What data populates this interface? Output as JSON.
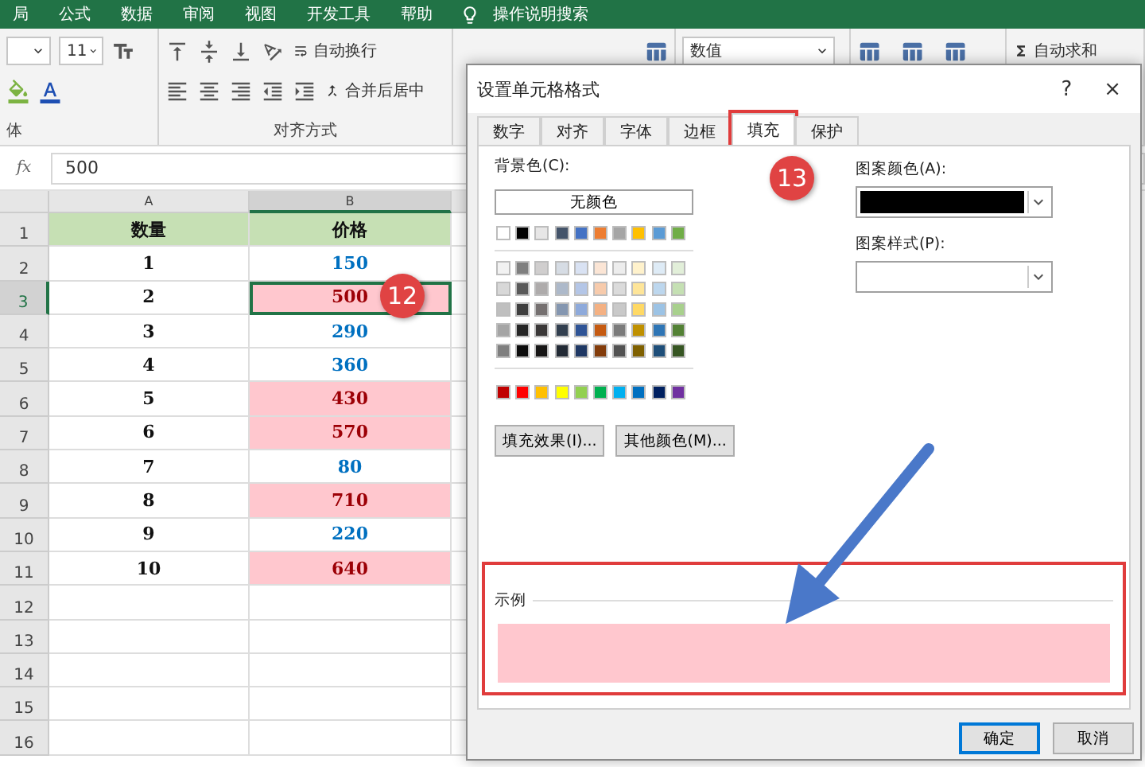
{
  "ribbon_tabs": [
    "局",
    "公式",
    "数据",
    "审阅",
    "视图",
    "开发工具",
    "帮助"
  ],
  "ribbon": {
    "search": "操作说明搜索",
    "font_size": "11",
    "font_group_label": "体",
    "wrap_text": "自动换行",
    "merge_center": "合并后居中",
    "alignment_group_label": "对齐方式",
    "number_format": "数值",
    "autosum": "自动求和"
  },
  "formula_bar": {
    "function_label": "fx",
    "value": "500"
  },
  "sheet": {
    "columns": [
      {
        "label": "A",
        "selected": false
      },
      {
        "label": "B",
        "selected": true
      }
    ],
    "rows": [
      {
        "number": "1",
        "selected": false,
        "kind": "header",
        "a": "数量",
        "b": "价格"
      },
      {
        "number": "2",
        "selected": false,
        "kind": "data",
        "a": "1",
        "b": "150",
        "highlighted": false
      },
      {
        "number": "3",
        "selected": true,
        "kind": "data",
        "a": "2",
        "b": "500",
        "highlighted": true
      },
      {
        "number": "4",
        "selected": false,
        "kind": "data",
        "a": "3",
        "b": "290",
        "highlighted": false
      },
      {
        "number": "5",
        "selected": false,
        "kind": "data",
        "a": "4",
        "b": "360",
        "highlighted": false
      },
      {
        "number": "6",
        "selected": false,
        "kind": "data",
        "a": "5",
        "b": "430",
        "highlighted": true
      },
      {
        "number": "7",
        "selected": false,
        "kind": "data",
        "a": "6",
        "b": "570",
        "highlighted": true
      },
      {
        "number": "8",
        "selected": false,
        "kind": "data",
        "a": "7",
        "b": "80",
        "highlighted": false
      },
      {
        "number": "9",
        "selected": false,
        "kind": "data",
        "a": "8",
        "b": "710",
        "highlighted": true
      },
      {
        "number": "10",
        "selected": false,
        "kind": "data",
        "a": "9",
        "b": "220",
        "highlighted": false
      },
      {
        "number": "11",
        "selected": false,
        "kind": "data",
        "a": "10",
        "b": "640",
        "highlighted": true
      },
      {
        "number": "12",
        "selected": false,
        "kind": "empty"
      },
      {
        "number": "13",
        "selected": false,
        "kind": "empty"
      },
      {
        "number": "14",
        "selected": false,
        "kind": "empty"
      },
      {
        "number": "15",
        "selected": false,
        "kind": "empty"
      },
      {
        "number": "16",
        "selected": false,
        "kind": "empty"
      }
    ]
  },
  "dialog": {
    "title": "设置单元格格式",
    "help": "?",
    "close": "×",
    "tabs": [
      {
        "label": "数字",
        "selected": false,
        "annotated": false
      },
      {
        "label": "对齐",
        "selected": false,
        "annotated": false
      },
      {
        "label": "字体",
        "selected": false,
        "annotated": false
      },
      {
        "label": "边框",
        "selected": false,
        "annotated": false
      },
      {
        "label": "填充",
        "selected": true,
        "annotated": true
      },
      {
        "label": "保护",
        "selected": false,
        "annotated": false
      }
    ],
    "background_label": "背景色(C):",
    "no_color": "无颜色",
    "palette": {
      "theme": [
        {
          "color": "#ffffff"
        },
        {
          "color": "#000000"
        },
        {
          "color": "#e7e6e6"
        },
        {
          "color": "#44546a"
        },
        {
          "color": "#4472c4"
        },
        {
          "color": "#ed7d31"
        },
        {
          "color": "#a5a5a5"
        },
        {
          "color": "#ffc000"
        },
        {
          "color": "#5b9bd5"
        },
        {
          "color": "#70ad47"
        }
      ],
      "tints": [
        [
          {
            "color": "#f2f2f2"
          },
          {
            "color": "#7f7f7f"
          },
          {
            "color": "#d0cece"
          },
          {
            "color": "#d6dce4"
          },
          {
            "color": "#d9e2f3"
          },
          {
            "color": "#fbe5d5"
          },
          {
            "color": "#ededed"
          },
          {
            "color": "#fff2cc"
          },
          {
            "color": "#deebf6"
          },
          {
            "color": "#e2efd9"
          }
        ],
        [
          {
            "color": "#d8d8d8"
          },
          {
            "color": "#595959"
          },
          {
            "color": "#aeabab"
          },
          {
            "color": "#adb9ca"
          },
          {
            "color": "#b4c6e7"
          },
          {
            "color": "#f7cbac"
          },
          {
            "color": "#dbdbdb"
          },
          {
            "color": "#fee599"
          },
          {
            "color": "#bdd7ee"
          },
          {
            "color": "#c5e0b3"
          }
        ],
        [
          {
            "color": "#bfbfbf"
          },
          {
            "color": "#3f3f3f"
          },
          {
            "color": "#757070"
          },
          {
            "color": "#8496b0"
          },
          {
            "color": "#8eaadb"
          },
          {
            "color": "#f4b183"
          },
          {
            "color": "#c9c9c9"
          },
          {
            "color": "#ffd965"
          },
          {
            "color": "#9cc3e5"
          },
          {
            "color": "#a8d08d"
          }
        ],
        [
          {
            "color": "#a5a5a5"
          },
          {
            "color": "#262626"
          },
          {
            "color": "#3a3838"
          },
          {
            "color": "#323f4f"
          },
          {
            "color": "#2f5496"
          },
          {
            "color": "#c55a11"
          },
          {
            "color": "#7b7b7b"
          },
          {
            "color": "#bf9000"
          },
          {
            "color": "#2e75b5"
          },
          {
            "color": "#538135"
          }
        ],
        [
          {
            "color": "#7f7f7f"
          },
          {
            "color": "#0c0c0c"
          },
          {
            "color": "#171616"
          },
          {
            "color": "#222a35"
          },
          {
            "color": "#1f3864"
          },
          {
            "color": "#833c0b"
          },
          {
            "color": "#525252"
          },
          {
            "color": "#7f6000"
          },
          {
            "color": "#1e4e79"
          },
          {
            "color": "#375623"
          }
        ]
      ],
      "standard": [
        {
          "color": "#c00000"
        },
        {
          "color": "#ff0000"
        },
        {
          "color": "#ffc000"
        },
        {
          "color": "#ffff00"
        },
        {
          "color": "#92d050"
        },
        {
          "color": "#00b050"
        },
        {
          "color": "#00b0f0"
        },
        {
          "color": "#0070c0"
        },
        {
          "color": "#002060"
        },
        {
          "color": "#7030a0"
        }
      ]
    },
    "fill_effects": "填充效果(I)...",
    "more_colors": "其他颜色(M)...",
    "pattern_color_label": "图案颜色(A):",
    "pattern_color": {
      "color": "#000000"
    },
    "pattern_style_label": "图案样式(P):",
    "sample_label": "示例",
    "sample": {
      "color": "#ffc7ce",
      "annotated": true
    },
    "ok": "确定",
    "cancel": "取消"
  },
  "callouts": [
    "12",
    "13"
  ]
}
